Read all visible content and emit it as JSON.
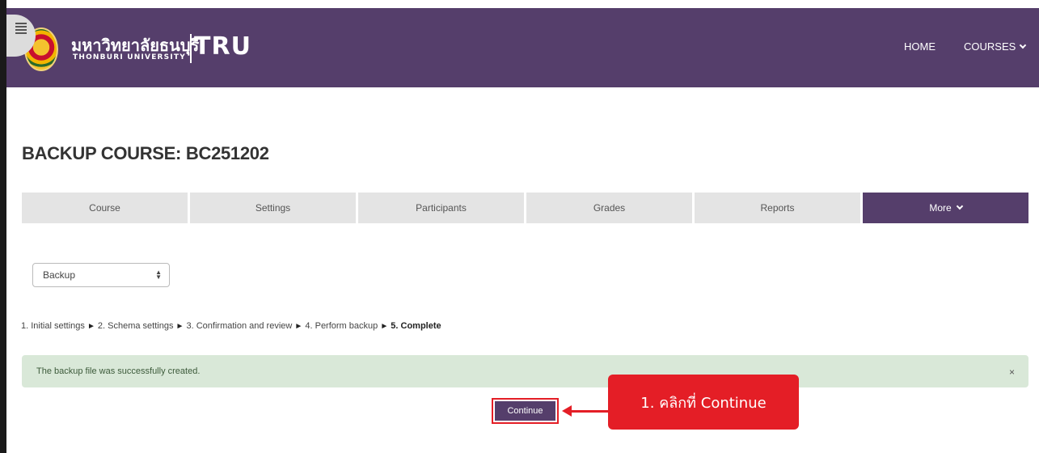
{
  "header": {
    "logo_thai": "มหาวิทยาลัยธนบุรี",
    "logo_english": "THONBURI UNIVERSITY",
    "logo_short": "TRU",
    "nav": {
      "home": "HOME",
      "courses": "COURSES"
    }
  },
  "page": {
    "title": "BACKUP COURSE: BC251202"
  },
  "tabs": [
    {
      "label": "Course"
    },
    {
      "label": "Settings"
    },
    {
      "label": "Participants"
    },
    {
      "label": "Grades"
    },
    {
      "label": "Reports"
    },
    {
      "label": "More"
    }
  ],
  "select": {
    "value": "Backup"
  },
  "steps": {
    "s1": "1. Initial settings",
    "s2": "2. Schema settings",
    "s3": "3. Confirmation and review",
    "s4": "4. Perform backup",
    "s5": "5. Complete",
    "separator": "►"
  },
  "alert": {
    "message": "The backup file was successfully created.",
    "close": "×"
  },
  "continue_button": {
    "label": "Continue"
  },
  "annotation": {
    "text": "1. คลิกที่ Continue"
  },
  "colors": {
    "brand": "#553e6b",
    "annotation": "#e41e26",
    "alert_bg": "#d9e8d8"
  }
}
